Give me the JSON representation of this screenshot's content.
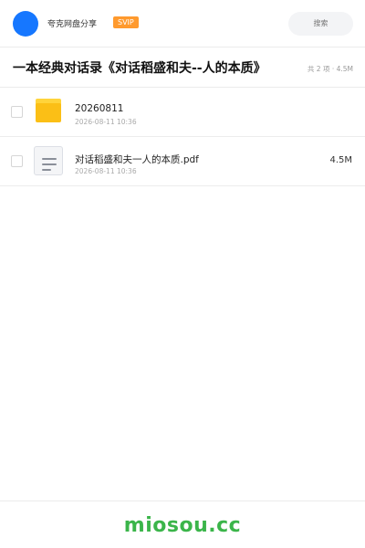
{
  "header": {
    "share_name": "夸克网盘分享",
    "badge": "SVIP",
    "search_placeholder": "搜索",
    "avatar_color": "#1677ff",
    "badge_color": "#ff9a2e"
  },
  "title_row": {
    "title": "一本经典对话录《对话稻盛和夫--人的本质》",
    "summary": "共 2 项 · 4.5M"
  },
  "files": [
    {
      "name": "20260811",
      "date": "2026-08-11 10:36",
      "size": "",
      "type": "folder",
      "icon": "folder-icon"
    },
    {
      "name": "对话稻盛和夫一人的本质.pdf",
      "date": "2026-08-11 10:36",
      "size": "4.5M",
      "type": "pdf",
      "icon": "document-icon"
    }
  ],
  "footer": {
    "brand": "miosou.cc",
    "brand_color": "#3bb54a"
  }
}
